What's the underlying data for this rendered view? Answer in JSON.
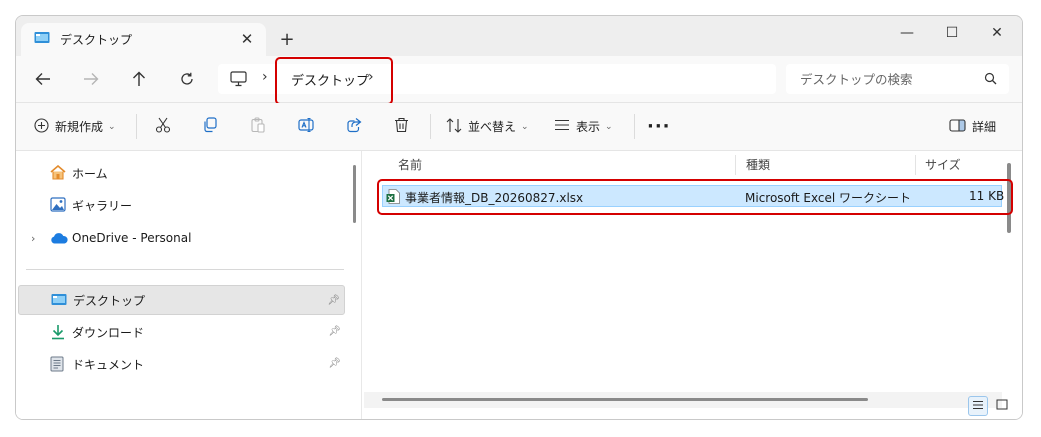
{
  "window": {
    "tab_title": "デスクトップ",
    "tab_close": "✕",
    "new_tab": "+",
    "minimize": "—",
    "maximize": "☐",
    "close": "✕"
  },
  "address": {
    "crumb": "デスクトップ",
    "sep": "›",
    "search_placeholder": "デスクトップの検索"
  },
  "toolbar": {
    "new_label": "新規作成",
    "sort_label": "並べ替え",
    "view_label": "表示",
    "more_label": "···",
    "details_label": "詳細"
  },
  "nav": {
    "items": [
      {
        "label": "ホーム"
      },
      {
        "label": "ギャラリー"
      },
      {
        "label": "OneDrive - Personal"
      },
      {
        "label": "デスクトップ"
      },
      {
        "label": "ダウンロード"
      },
      {
        "label": "ドキュメント"
      }
    ]
  },
  "files": {
    "columns": {
      "name": "名前",
      "type": "種類",
      "size": "サイズ"
    },
    "rows": [
      {
        "name": "事業者情報_DB_20260827.xlsx",
        "type": "Microsoft Excel ワークシート",
        "size": "11 KB"
      }
    ]
  },
  "colors": {
    "highlight": "#d40000",
    "selection_bg": "#cce8ff",
    "excel_green": "#1d6f42",
    "folder_blue": "#2f8fd8"
  }
}
